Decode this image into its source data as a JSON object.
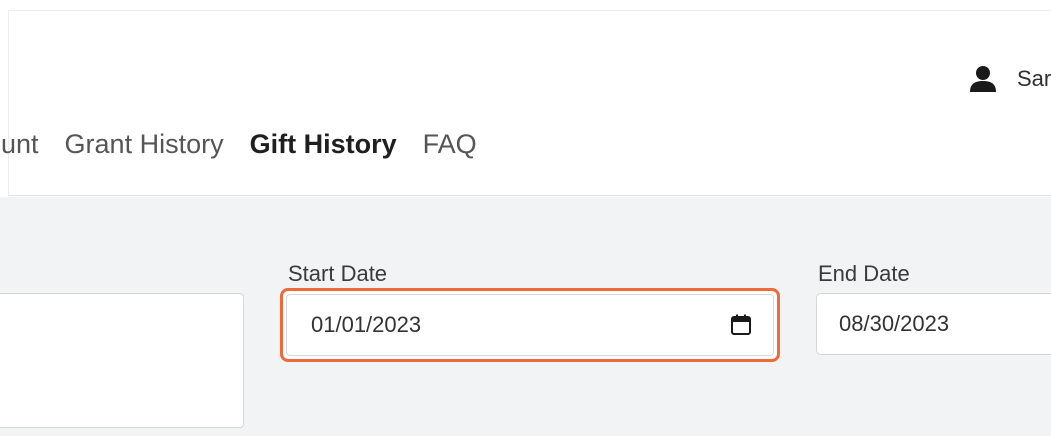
{
  "header": {
    "user_name": "Sara",
    "user_icon": "person-icon",
    "nav_items": [
      {
        "label": "unt",
        "active": false
      },
      {
        "label": "Grant History",
        "active": false
      },
      {
        "label": "Gift History",
        "active": true
      },
      {
        "label": "FAQ",
        "active": false
      }
    ]
  },
  "filters": {
    "start_date": {
      "label": "Start Date",
      "value": "01/01/2023",
      "icon": "calendar-icon"
    },
    "end_date": {
      "label": "End Date",
      "value": "08/30/2023"
    }
  },
  "colors": {
    "highlight": "#ee6a3b",
    "background": "#f2f3f5",
    "active_nav": "#1f1f1f"
  }
}
